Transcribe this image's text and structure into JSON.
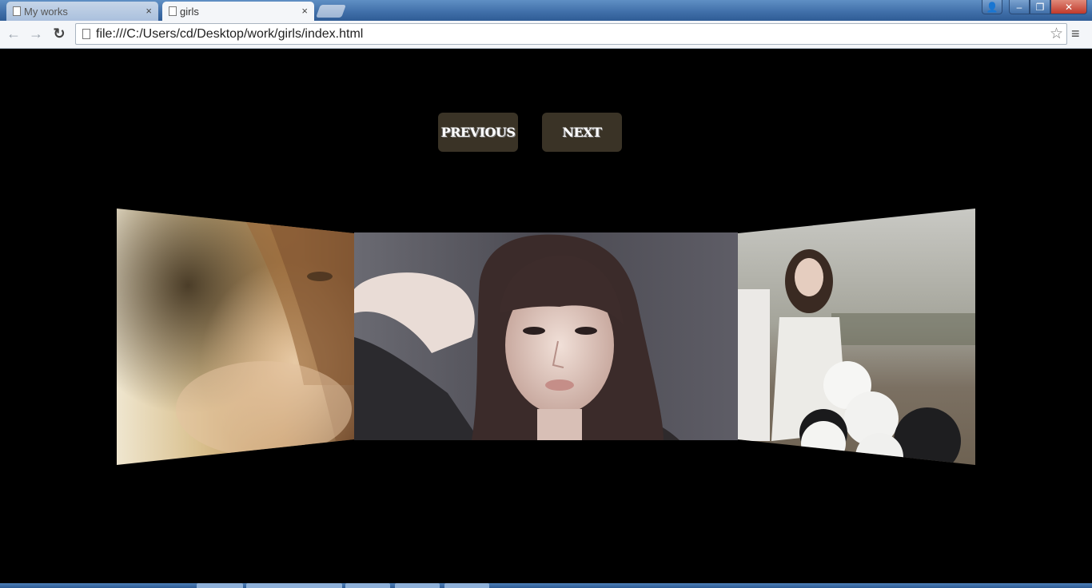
{
  "browser": {
    "tabs": [
      {
        "label": "My works",
        "active": false
      },
      {
        "label": "girls",
        "active": true
      }
    ],
    "close_glyph": "×",
    "window_controls": {
      "minimize": "–",
      "maximize": "❐",
      "close": "✕",
      "user": "👤"
    },
    "nav": {
      "back": "←",
      "forward": "→",
      "reload": "↻",
      "menu": "≡",
      "bookmark": "☆"
    },
    "address": {
      "url": "file:///C:/Users/cd/Desktop/work/girls/index.html"
    }
  },
  "page": {
    "buttons": {
      "previous": "PREVIOUS",
      "next": "NEXT"
    },
    "button_color": "#3a3326",
    "slides": [
      {
        "position": "left",
        "subject": "woman-closeup-photo",
        "palette": [
          "#f2ead8",
          "#c9a66a",
          "#7a5a3a"
        ]
      },
      {
        "position": "center",
        "subject": "woman-portrait-photo",
        "palette": [
          "#5a5a62",
          "#2e2426",
          "#e8d6cf"
        ]
      },
      {
        "position": "right",
        "subject": "women-with-balloons-photo",
        "palette": [
          "#b8b4ab",
          "#ffffff",
          "#1c1c1c"
        ]
      }
    ]
  }
}
